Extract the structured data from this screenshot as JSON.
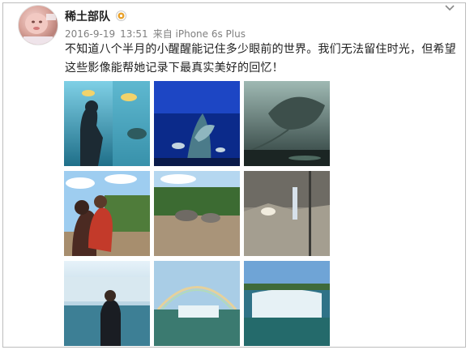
{
  "post": {
    "username": "稀土部队",
    "verified_icon": "weibo-vip-icon",
    "date": "2016-9-19",
    "time": "13:51",
    "source": "来自 iPhone 6s Plus",
    "text": "不知道八个半月的小醒醒能记住多少眼前的世界。我们无法留住时光，但希望这些影像能帮她记录下最真实美好的回忆！",
    "menu_icon": "chevron-down-icon"
  },
  "photos": [
    {
      "name": "aquarium-silhouette-photo"
    },
    {
      "name": "aquarium-blue-tank-photo"
    },
    {
      "name": "stingray-tank-photo"
    },
    {
      "name": "mother-child-park-photo"
    },
    {
      "name": "rhinos-enclosure-photo"
    },
    {
      "name": "polar-bear-rocks-photo"
    },
    {
      "name": "woman-at-falls-photo"
    },
    {
      "name": "rainbow-falls-photo"
    },
    {
      "name": "horseshoe-falls-photo"
    }
  ],
  "colors": {
    "username": "#222222",
    "meta": "#808080",
    "text": "#222222",
    "vip_badge": "#e8a12a"
  }
}
